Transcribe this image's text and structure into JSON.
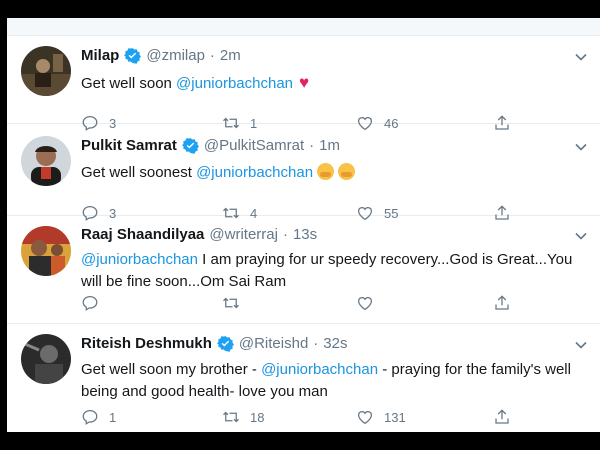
{
  "tweets": [
    {
      "name": "Milap",
      "handle": "@zmilap",
      "time": "2m",
      "text_before": "Get well soon ",
      "mention": "@juniorbachchan",
      "text_after": "",
      "emoji": "red-heart",
      "replies": "3",
      "retweets": "1",
      "likes": "46"
    },
    {
      "name": "Pulkit Samrat",
      "handle": "@PulkitSamrat",
      "time": "1m",
      "text_before": "Get well soonest ",
      "mention": "@juniorbachchan",
      "text_after": "",
      "emoji": "hugging-face x2",
      "replies": "3",
      "retweets": "4",
      "likes": "55"
    },
    {
      "name": "Raaj Shaandilyaa",
      "handle": "@writerraj",
      "time": "13s",
      "text_before": "",
      "mention": "@juniorbachchan",
      "text_after": " I am praying for ur speedy recovery...God is Great...You will be fine soon...Om Sai Ram",
      "emoji": "",
      "replies": "",
      "retweets": "",
      "likes": ""
    },
    {
      "name": "Riteish Deshmukh",
      "handle": "@Riteishd",
      "time": "32s",
      "text_before": "Get well soon my brother - ",
      "mention": "@juniorbachchan",
      "text_after": " - praying for the family's well being and good health- love you man",
      "emoji": "",
      "replies": "1",
      "retweets": "18",
      "likes": "131"
    }
  ],
  "colors": {
    "accent": "#1b95e0",
    "verified": "#1da1f2",
    "muted": "#657786",
    "heart": "#e0245e"
  },
  "icons": [
    "verified-badge-icon",
    "chevron-down-icon",
    "reply-icon",
    "retweet-icon",
    "like-icon",
    "share-icon"
  ]
}
